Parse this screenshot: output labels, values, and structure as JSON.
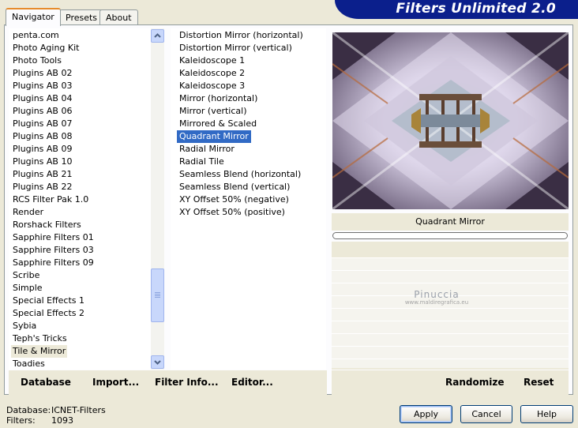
{
  "app": {
    "title": "Filters Unlimited 2.0"
  },
  "tabs": [
    {
      "label": "Navigator",
      "active": true
    },
    {
      "label": "Presets",
      "active": false
    },
    {
      "label": "About",
      "active": false
    }
  ],
  "categories": {
    "items": [
      "penta.com",
      "Photo Aging Kit",
      "Photo Tools",
      "Plugins AB 02",
      "Plugins AB 03",
      "Plugins AB 04",
      "Plugins AB 06",
      "Plugins AB 07",
      "Plugins AB 08",
      "Plugins AB 09",
      "Plugins AB 10",
      "Plugins AB 21",
      "Plugins AB 22",
      "RCS Filter Pak 1.0",
      "Render",
      "Rorshack Filters",
      "Sapphire Filters 01",
      "Sapphire Filters 03",
      "Sapphire Filters 09",
      "Scribe",
      "Simple",
      "Special Effects 1",
      "Special Effects 2",
      "Sybia",
      "Teph's Tricks",
      "Tile & Mirror",
      "Toadies"
    ],
    "selected": "Tile & Mirror"
  },
  "filters": {
    "items": [
      "Distortion Mirror (horizontal)",
      "Distortion Mirror (vertical)",
      "Kaleidoscope 1",
      "Kaleidoscope 2",
      "Kaleidoscope 3",
      "Mirror (horizontal)",
      "Mirror (vertical)",
      "Mirrored & Scaled",
      "Quadrant Mirror",
      "Radial Mirror",
      "Radial Tile",
      "Seamless Blend (horizontal)",
      "Seamless Blend (vertical)",
      "XY Offset 50% (negative)",
      "XY Offset 50% (positive)"
    ],
    "selected": "Quadrant Mirror"
  },
  "preview": {
    "filter_name": "Quadrant Mirror",
    "watermark": {
      "title": "Pinuccia",
      "url": "www.maldiregrafica.eu"
    }
  },
  "left_buttons": {
    "database": "Database",
    "import": "Import...",
    "filter_info": "Filter Info...",
    "editor": "Editor..."
  },
  "right_buttons": {
    "randomize": "Randomize",
    "reset": "Reset"
  },
  "status": {
    "database_label": "Database:",
    "database_value": "ICNET-Filters",
    "filters_label": "Filters:",
    "filters_value": "1093"
  },
  "dialog_buttons": {
    "apply": "Apply",
    "cancel": "Cancel",
    "help": "Help"
  },
  "colors": {
    "banner": "#0b1f8c",
    "selection": "#316ac5",
    "active_tab_accent": "#e68b2c"
  }
}
